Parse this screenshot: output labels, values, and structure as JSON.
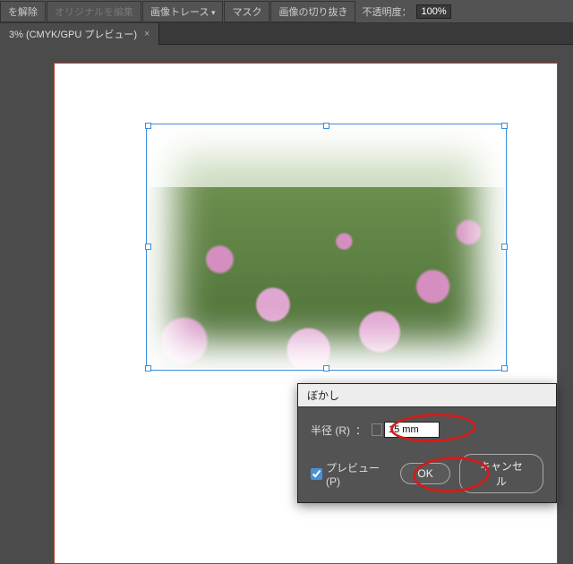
{
  "toolbar": {
    "release_link": "を解除",
    "edit_original": "オリジナルを編集",
    "image_trace": "画像トレース",
    "mask": "マスク",
    "crop_image": "画像の切り抜き",
    "opacity_label": "不透明度：",
    "opacity_value": "100%"
  },
  "tab": {
    "title": "3% (CMYK/GPU プレビュー)",
    "close": "×"
  },
  "dialog": {
    "title": "ぼかし",
    "radius_label": "半径 (R)",
    "colon": "：",
    "radius_value": "15 mm",
    "preview_label": "プレビュー (P)",
    "preview_checked": true,
    "ok_label": "OK",
    "cancel_label": "キャンセル"
  }
}
